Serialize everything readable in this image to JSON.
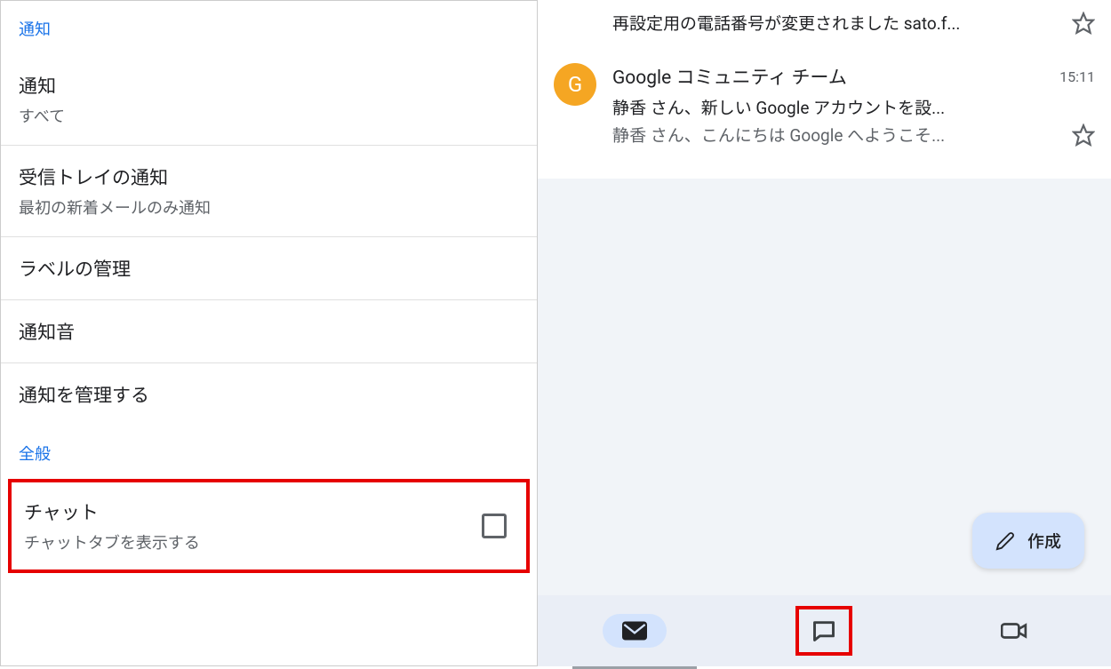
{
  "settings": {
    "section1_header": "通知",
    "items": [
      {
        "title": "通知",
        "subtitle": "すべて"
      },
      {
        "title": "受信トレイの通知",
        "subtitle": "最初の新着メールのみ通知"
      },
      {
        "title": "ラベルの管理"
      },
      {
        "title": "通知音"
      },
      {
        "title": "通知を管理する"
      }
    ],
    "section2_header": "全般",
    "chat_item": {
      "title": "チャット",
      "subtitle": "チャットタブを表示する"
    }
  },
  "inbox": {
    "partial_email": {
      "preview": "再設定用の電話番号が変更されました sato.f..."
    },
    "emails": [
      {
        "avatar_letter": "G",
        "sender": "Google コミュニティ チーム",
        "time": "15:11",
        "subject": "静香 さん、新しい Google アカウントを設...",
        "preview": "静香 さん、こんにちは Google へようこそ..."
      }
    ]
  },
  "compose": {
    "label": "作成"
  }
}
